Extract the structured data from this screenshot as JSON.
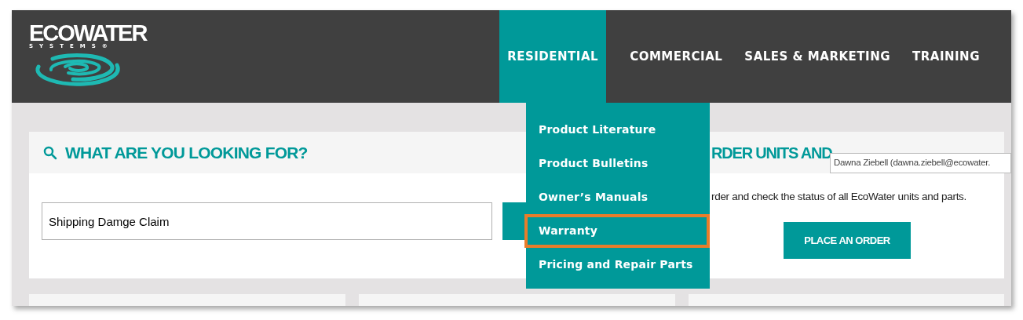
{
  "logo": {
    "name": "ECOWATER",
    "tagline": "SYSTEMS®"
  },
  "nav": [
    {
      "label": "RESIDENTIAL",
      "selected": true
    },
    {
      "label": "COMMERCIAL",
      "selected": false
    },
    {
      "label": "SALES & MARKETING",
      "selected": false
    },
    {
      "label": "TRAINING",
      "selected": false
    }
  ],
  "dropdown": [
    {
      "label": "Product Literature",
      "highlighted": false
    },
    {
      "label": "Product Bulletins",
      "highlighted": false
    },
    {
      "label": "Owner’s Manuals",
      "highlighted": false
    },
    {
      "label": "Warranty",
      "highlighted": true
    },
    {
      "label": "Pricing and Repair Parts",
      "highlighted": false
    }
  ],
  "search_card": {
    "title": "WHAT ARE YOU LOOKING FOR?",
    "value": "Shipping Damge Claim"
  },
  "order_card": {
    "title": "RDER UNITS AND",
    "text": "rder and check the status of all EcoWater units and parts.",
    "button": "PLACE AN ORDER"
  },
  "tooltip": "Dawna Ziebell (dawna.ziebell@ecowater."
}
